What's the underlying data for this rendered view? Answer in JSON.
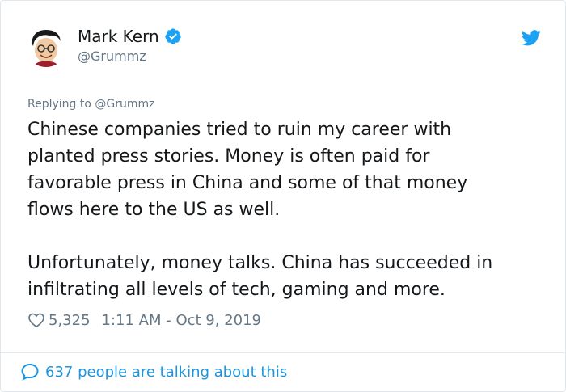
{
  "author": {
    "name": "Mark Kern",
    "handle": "@Grummz"
  },
  "icons": {
    "avatar": "avatar-illustration",
    "verified": "verified-badge-icon",
    "logo": "twitter-bird-icon",
    "like": "heart-outline-icon",
    "conversation": "speech-bubble-icon"
  },
  "colors": {
    "accent": "#1da1f2",
    "link": "#1b95e0",
    "muted": "#657786"
  },
  "tweet": {
    "reply_to": "Replying to @Grummz",
    "text": "Chinese companies tried to ruin my career with\nplanted press stories. Money is often paid for\nfavorable press in China and some of that money\nflows here to the US as well.\n\nUnfortunately, money talks. China has succeeded in\ninfiltrating all levels of tech, gaming and more.",
    "likes": "5,325",
    "timestamp": "1:11 AM - Oct 9, 2019"
  },
  "footer": {
    "talking": "637 people are talking about this"
  }
}
